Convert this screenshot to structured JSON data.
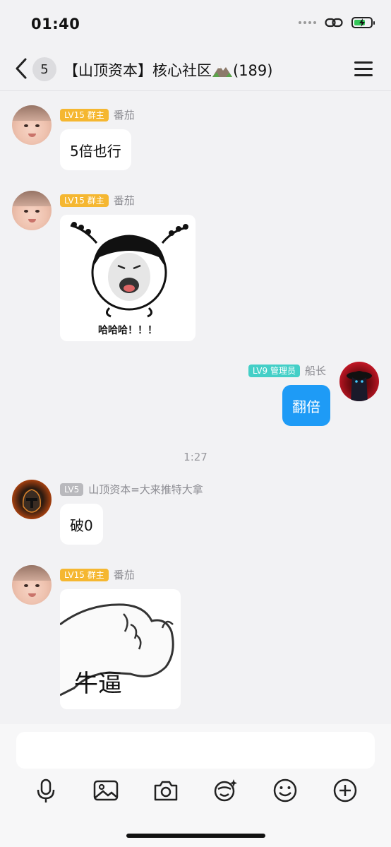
{
  "status_bar": {
    "time": "01:40",
    "battery_percent": 70
  },
  "nav": {
    "unread_count": "5",
    "title": "【山顶资本】核心社区",
    "member_count": "(189)",
    "icons": [
      "back-chevron-icon",
      "mountain-emoji-icon",
      "menu-icon"
    ]
  },
  "messages": [
    {
      "level": "LV15",
      "role": "群主",
      "nickname": "番茄",
      "text": "5倍也行"
    },
    {
      "level": "LV15",
      "role": "群主",
      "nickname": "番茄",
      "sticker_caption": "哈哈哈！！！"
    },
    {
      "level": "LV9",
      "role": "管理员",
      "nickname": "船长",
      "text": "翻倍"
    },
    {
      "level": "LV5",
      "nickname": "山顶资本=大来推特大拿",
      "text": "破0"
    },
    {
      "level": "LV15",
      "role": "群主",
      "nickname": "番茄",
      "sticker_caption": "牛逼"
    }
  ],
  "time_separator": "1:27",
  "input": {
    "placeholder": ""
  },
  "toolbar": {
    "icons": [
      "microphone-icon",
      "image-icon",
      "camera-icon",
      "sticker-search-icon",
      "emoji-icon",
      "plus-icon"
    ]
  },
  "colors": {
    "owner_badge": "#f5b731",
    "admin_badge": "#44cfc7",
    "member_badge": "#b9b9bd",
    "self_bubble": "#1e9bf6",
    "background": "#f2f2f4"
  }
}
